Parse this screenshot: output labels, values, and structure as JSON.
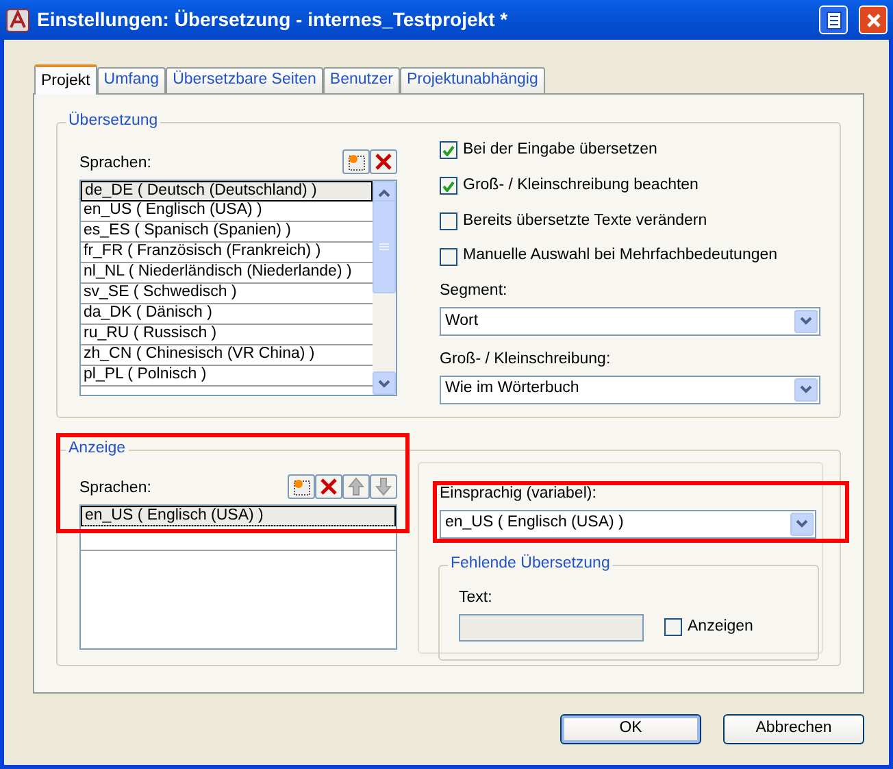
{
  "window": {
    "title": "Einstellungen: Übersetzung - internes_Testprojekt *"
  },
  "tabs": [
    {
      "label": "Projekt",
      "selected": true
    },
    {
      "label": "Umfang",
      "selected": false
    },
    {
      "label": "Übersetzbare Seiten",
      "selected": false
    },
    {
      "label": "Benutzer",
      "selected": false
    },
    {
      "label": "Projektunabhängig",
      "selected": false
    }
  ],
  "uebersetzung": {
    "legend": "Übersetzung",
    "languages_label": "Sprachen:",
    "languages": [
      {
        "text": "de_DE ( Deutsch (Deutschland) )",
        "selected": true
      },
      {
        "text": "en_US ( Englisch (USA) )",
        "selected": false
      },
      {
        "text": "es_ES ( Spanisch (Spanien) )",
        "selected": false
      },
      {
        "text": "fr_FR ( Französisch (Frankreich) )",
        "selected": false
      },
      {
        "text": "nl_NL ( Niederländisch (Niederlande) )",
        "selected": false
      },
      {
        "text": "sv_SE ( Schwedisch )",
        "selected": false
      },
      {
        "text": "da_DK ( Dänisch )",
        "selected": false
      },
      {
        "text": "ru_RU ( Russisch )",
        "selected": false
      },
      {
        "text": "zh_CN ( Chinesisch (VR China) )",
        "selected": false
      },
      {
        "text": "pl_PL ( Polnisch )",
        "selected": false
      }
    ],
    "options": [
      {
        "label": "Bei der Eingabe übersetzen",
        "checked": true
      },
      {
        "label": "Groß- / Kleinschreibung beachten",
        "checked": true
      },
      {
        "label": "Bereits übersetzte Texte verändern",
        "checked": false
      },
      {
        "label": "Manuelle Auswahl bei Mehrfachbedeutungen",
        "checked": false
      }
    ],
    "selects": [
      {
        "label": "Segment:",
        "value": "Wort"
      },
      {
        "label": "Groß- / Kleinschreibung:",
        "value": "Wie im Wörterbuch"
      }
    ]
  },
  "anzeige": {
    "legend": "Anzeige",
    "highlighted": true,
    "languages_label": "Sprachen:",
    "languages": [
      {
        "text": "en_US ( Englisch (USA) )",
        "selected": true
      }
    ],
    "monolingual": {
      "label": "Einsprachig (variabel):",
      "value": "en_US ( Englisch (USA) )",
      "highlighted": true
    },
    "missing": {
      "legend": "Fehlende Übersetzung",
      "text_label": "Text:",
      "show_label": "Anzeigen",
      "show_checked": false
    }
  },
  "buttons": [
    {
      "label": "OK",
      "default": true
    },
    {
      "label": "Abbrechen",
      "default": false
    }
  ]
}
